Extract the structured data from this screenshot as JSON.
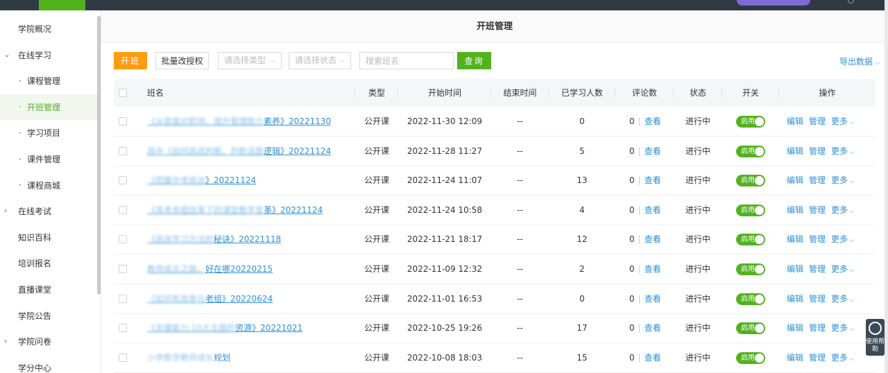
{
  "sidebar": {
    "items": [
      {
        "label": "学院概况",
        "type": "top",
        "arrow": ""
      },
      {
        "label": "在线学习",
        "type": "top",
        "arrow": "⌄"
      },
      {
        "label": "课程管理",
        "type": "sub"
      },
      {
        "label": "开班管理",
        "type": "sub",
        "active": true
      },
      {
        "label": "学习项目",
        "type": "sub"
      },
      {
        "label": "课件管理",
        "type": "sub"
      },
      {
        "label": "课程商城",
        "type": "sub"
      },
      {
        "label": "在线考试",
        "type": "top",
        "arrow": "›"
      },
      {
        "label": "知识百科",
        "type": "top",
        "arrow": ""
      },
      {
        "label": "培训报名",
        "type": "top",
        "arrow": ""
      },
      {
        "label": "直播课堂",
        "type": "top",
        "arrow": ""
      },
      {
        "label": "学院公告",
        "type": "top",
        "arrow": ""
      },
      {
        "label": "学院问卷",
        "type": "top",
        "arrow": "›"
      },
      {
        "label": "学分中心",
        "type": "top",
        "arrow": ""
      }
    ]
  },
  "page": {
    "title": "开班管理"
  },
  "toolbar": {
    "open_label": "开班",
    "batch_label": "批量改授权",
    "type_placeholder": "请选择类型",
    "status_placeholder": "请选择状态",
    "search_placeholder": "搜索班名",
    "search_label": "查询",
    "export_label": "导出数据"
  },
  "table": {
    "headers": {
      "name": "班名",
      "type": "类型",
      "start": "开始时间",
      "end": "结束时间",
      "learners": "已学习人数",
      "comments": "评论数",
      "status": "状态",
      "switch": "开关",
      "ops": "操作"
    },
    "rows": [
      {
        "name_hidden": "《从容面对职场，提升管理能力",
        "name_visible": "素养》20221130",
        "type": "公开课",
        "start": "2022-11-30 12:09",
        "end": "--",
        "learners": "0",
        "comments": "0",
        "view": "查看",
        "status": "进行中",
        "switch": "启用",
        "edit": "编辑",
        "manage": "管理",
        "more": "更多"
      },
      {
        "name_hidden": "高中《如何高效判断、判断话题",
        "name_visible": "逻辑》20221124",
        "type": "公开课",
        "start": "2022-11-28 11:27",
        "end": "--",
        "learners": "5",
        "comments": "0",
        "view": "查看",
        "status": "进行中",
        "switch": "启用",
        "edit": "编辑",
        "manage": "管理",
        "more": "更多"
      },
      {
        "name_hidden": "《把握中考政治",
        "name_visible": "》20221124",
        "type": "公开课",
        "start": "2022-11-24 11:07",
        "end": "--",
        "learners": "13",
        "comments": "0",
        "view": "查看",
        "status": "进行中",
        "switch": "启用",
        "edit": "编辑",
        "manage": "管理",
        "more": "更多"
      },
      {
        "name_hidden": "《高考命题改革下的课堂教学变",
        "name_visible": "革》20221124",
        "type": "公开课",
        "start": "2022-11-24 10:58",
        "end": "--",
        "learners": "4",
        "comments": "0",
        "view": "查看",
        "status": "进行中",
        "switch": "启用",
        "edit": "编辑",
        "manage": "管理",
        "more": "更多"
      },
      {
        "name_hidden": "《高效学习方法的",
        "name_visible": "秘诀》20221118",
        "type": "公开课",
        "start": "2022-11-21 18:17",
        "end": "--",
        "learners": "12",
        "comments": "0",
        "view": "查看",
        "status": "进行中",
        "switch": "启用",
        "edit": "编辑",
        "manage": "管理",
        "more": "更多"
      },
      {
        "name_hidden": "教师成长之路，",
        "name_visible": "好在哪20220215",
        "type": "公开课",
        "start": "2022-11-09 12:32",
        "end": "--",
        "learners": "2",
        "comments": "0",
        "view": "查看",
        "status": "进行中",
        "switch": "启用",
        "edit": "编辑",
        "manage": "管理",
        "more": "更多"
      },
      {
        "name_hidden": "《如何有效参与",
        "name_visible": "老组》20220624",
        "type": "公开课",
        "start": "2022-11-01 16:53",
        "end": "--",
        "learners": "0",
        "comments": "0",
        "view": "查看",
        "status": "进行中",
        "switch": "启用",
        "edit": "编辑",
        "manage": "管理",
        "more": "更多"
      },
      {
        "name_hidden": "《关键能力·10大主题的",
        "name_visible": "资源》20221021",
        "type": "公开课",
        "start": "2022-10-25 19:26",
        "end": "--",
        "learners": "17",
        "comments": "0",
        "view": "查看",
        "status": "进行中",
        "switch": "启用",
        "edit": "编辑",
        "manage": "管理",
        "more": "更多"
      },
      {
        "name_hidden": "小学数学教师成长",
        "name_visible": "规划",
        "type": "公开课",
        "start": "2022-10-08 18:03",
        "end": "--",
        "learners": "15",
        "comments": "0",
        "view": "查看",
        "status": "进行中",
        "switch": "启用",
        "edit": "编辑",
        "manage": "管理",
        "more": "更多"
      }
    ]
  },
  "help": {
    "label": "使用帮助"
  },
  "colors": {
    "accent": "#52b21e",
    "primary_button": "#ff9c12",
    "link": "#2b91d6"
  }
}
